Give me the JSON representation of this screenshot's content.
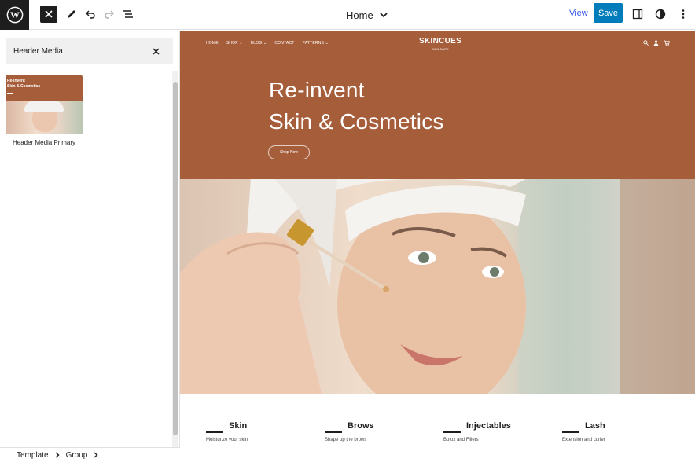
{
  "toolbar": {
    "doc_title": "Home",
    "view_label": "View",
    "save_label": "Save"
  },
  "sidebar": {
    "search_value": "Header Media",
    "pattern": {
      "preview_title_line1": "Re-invent",
      "preview_title_line2": "Skin & Cosmetics",
      "label": "Header Media Primary"
    },
    "breadcrumb": [
      "Template",
      "Group"
    ]
  },
  "site": {
    "nav": [
      "HOME",
      "SHOP ⌄",
      "BLOG ⌄",
      "CONTACT",
      "PATTERNS ⌄"
    ],
    "title": "SKINCUES",
    "tagline": "SKIN CARE",
    "hero_line1": "Re-invent",
    "hero_line2": "Skin & Cosmetics",
    "hero_button": "Shop Now",
    "services": [
      {
        "title": "Skin",
        "desc": "Moisturize your skin"
      },
      {
        "title": "Brows",
        "desc": "Shape up the brows"
      },
      {
        "title": "Injectables",
        "desc": "Botox and Fillers"
      },
      {
        "title": "Lash",
        "desc": "Extension and curler"
      }
    ]
  },
  "colors": {
    "accent": "#a65d3a",
    "primary_button": "#007cba",
    "link": "#3858e9",
    "dark": "#1e1e1e"
  }
}
